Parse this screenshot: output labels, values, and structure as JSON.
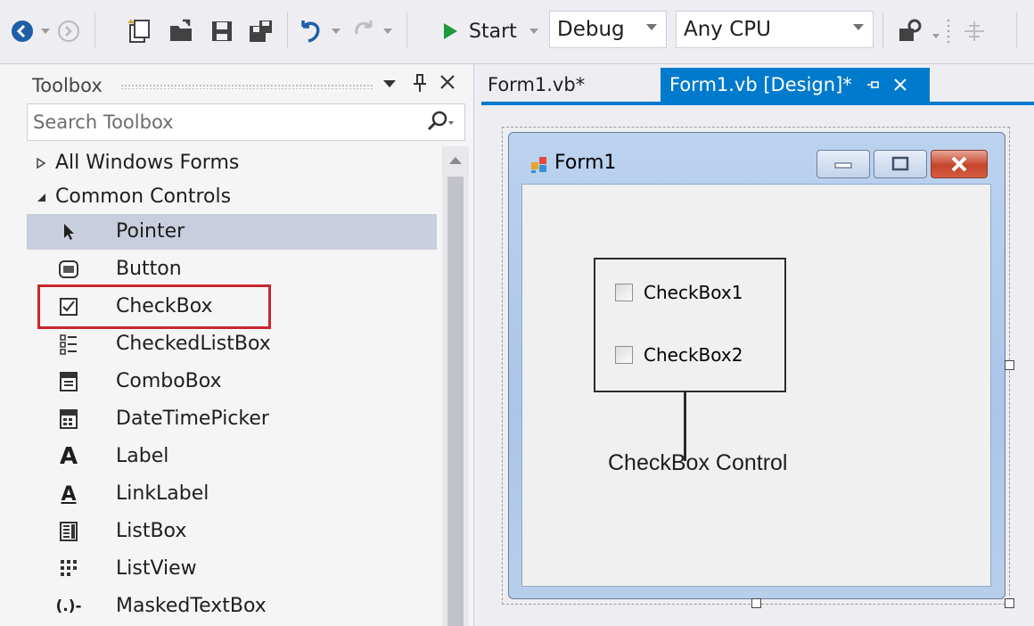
{
  "toolbar": {
    "start_label": "Start",
    "config_value": "Debug",
    "platform_value": "Any CPU"
  },
  "toolbox": {
    "title": "Toolbox",
    "search_placeholder": "Search Toolbox",
    "groups": [
      {
        "label": "All Windows Forms",
        "expanded": false
      },
      {
        "label": "Common Controls",
        "expanded": true
      }
    ],
    "items": [
      {
        "label": "Pointer",
        "icon": "pointer-arrow-icon",
        "selected": true
      },
      {
        "label": "Button",
        "icon": "button-control-icon"
      },
      {
        "label": "CheckBox",
        "icon": "checkbox-control-icon",
        "highlighted": true
      },
      {
        "label": "CheckedListBox",
        "icon": "checked-list-icon"
      },
      {
        "label": "ComboBox",
        "icon": "combobox-control-icon"
      },
      {
        "label": "DateTimePicker",
        "icon": "calendar-icon"
      },
      {
        "label": "Label",
        "icon": "label-a-icon"
      },
      {
        "label": "LinkLabel",
        "icon": "linklabel-a-icon"
      },
      {
        "label": "ListBox",
        "icon": "listbox-control-icon"
      },
      {
        "label": "ListView",
        "icon": "listview-control-icon"
      },
      {
        "label": "MaskedTextBox",
        "icon": "masked-text-icon"
      }
    ],
    "masked_icon_text": "(.)-",
    "label_icon_text": "A"
  },
  "tabs": [
    {
      "label": "Form1.vb*",
      "active": false
    },
    {
      "label": "Form1.vb [Design]*",
      "active": true
    }
  ],
  "form": {
    "title": "Form1",
    "checkboxes": [
      {
        "label": "CheckBox1",
        "checked": false
      },
      {
        "label": "CheckBox2",
        "checked": false
      }
    ]
  },
  "annotation": "CheckBox Control",
  "colors": {
    "accent": "#007acc",
    "highlight_border": "#c9262d"
  }
}
